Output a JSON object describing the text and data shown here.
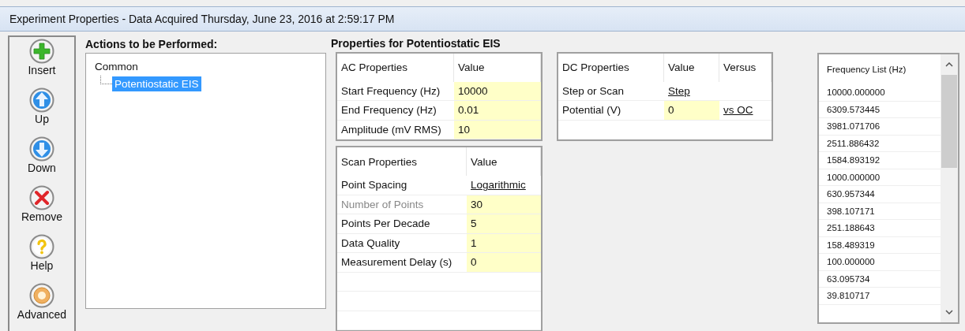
{
  "window": {
    "title": "Experiment Properties - Data Acquired Thursday, June 23, 2016 at 2:59:17 PM"
  },
  "toolbar": [
    {
      "kind": "insert",
      "label": "Insert"
    },
    {
      "kind": "up",
      "label": "Up"
    },
    {
      "kind": "down",
      "label": "Down"
    },
    {
      "kind": "remove",
      "label": "Remove"
    },
    {
      "kind": "help",
      "label": "Help"
    },
    {
      "kind": "advanced",
      "label": "Advanced"
    }
  ],
  "actions": {
    "heading": "Actions to be Performed:",
    "tree": [
      {
        "label": "Common",
        "selected": false,
        "children": [
          {
            "label": "Potentiostatic EIS",
            "selected": true
          }
        ]
      }
    ]
  },
  "properties": {
    "heading": "Properties for Potentiostatic EIS",
    "ac_table": {
      "columns": [
        "AC Properties",
        "Value"
      ],
      "rows": [
        {
          "label": "Start Frequency (Hz)",
          "kind": "field",
          "value": "10000",
          "disabled": false
        },
        {
          "label": "End Frequency (Hz)",
          "kind": "field",
          "value": "0.01",
          "disabled": false
        },
        {
          "label": "Amplitude (mV RMS)",
          "kind": "field",
          "value": "10",
          "disabled": false
        }
      ]
    },
    "scan_table": {
      "columns": [
        "Scan Properties",
        "Value"
      ],
      "rows": [
        {
          "label": "Point Spacing",
          "kind": "link",
          "value": "Logarithmic",
          "disabled": false
        },
        {
          "label": "Number of Points",
          "kind": "field",
          "value": "30",
          "disabled": true
        },
        {
          "label": "Points Per Decade",
          "kind": "field",
          "value": "5",
          "disabled": false
        },
        {
          "label": "Data Quality",
          "kind": "field",
          "value": "1",
          "disabled": false
        },
        {
          "label": "Measurement Delay (s)",
          "kind": "field",
          "value": "0",
          "disabled": false
        }
      ]
    },
    "dc_table": {
      "columns": [
        "DC Properties",
        "Value",
        "Versus"
      ],
      "rows": [
        {
          "label": "Step or Scan",
          "kind": "link",
          "value": "Step",
          "disabled": false
        },
        {
          "label": "Potential (V)",
          "kind": "field",
          "value": "0",
          "disabled": false,
          "versus": "vs OC"
        }
      ]
    }
  },
  "frequency_list": {
    "heading": "Frequency List (Hz)",
    "items": [
      "10000.000000",
      "6309.573445",
      "3981.071706",
      "2511.886432",
      "1584.893192",
      "1000.000000",
      "630.957344",
      "398.107171",
      "251.188643",
      "158.489319",
      "100.000000",
      "63.095734",
      "39.810717"
    ]
  }
}
